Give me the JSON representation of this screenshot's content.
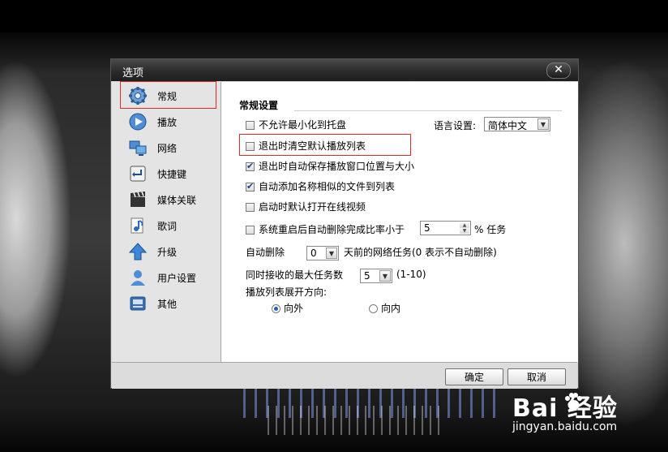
{
  "dialog": {
    "title": "选项",
    "close_glyph": "✕"
  },
  "sidebar": {
    "items": [
      {
        "label": "常规",
        "icon": "gear-icon",
        "active": true
      },
      {
        "label": "播放",
        "icon": "play-icon",
        "active": false
      },
      {
        "label": "网络",
        "icon": "network-icon",
        "active": false
      },
      {
        "label": "快捷键",
        "icon": "enter-key-icon",
        "active": false
      },
      {
        "label": "媒体关联",
        "icon": "film-clapper-icon",
        "active": false
      },
      {
        "label": "歌词",
        "icon": "lyrics-note-icon",
        "active": false
      },
      {
        "label": "升级",
        "icon": "upgrade-arrow-icon",
        "active": false
      },
      {
        "label": "用户设置",
        "icon": "user-icon",
        "active": false
      },
      {
        "label": "其他",
        "icon": "other-icon",
        "active": false
      }
    ]
  },
  "general": {
    "section_title": "常规设置",
    "opt_no_minimize_tray": {
      "label": "不允许最小化到托盘",
      "checked": false
    },
    "language_label": "语言设置:",
    "language_value": "简体中文",
    "opt_clear_playlist": {
      "label": "退出时清空默认播放列表",
      "checked": false
    },
    "opt_save_window_pos": {
      "label": "退出时自动保存播放窗口位置与大小",
      "checked": true
    },
    "opt_auto_add_similar": {
      "label": "自动添加名称相似的文件到列表",
      "checked": true
    },
    "opt_open_online_video": {
      "label": "启动时默认打开在线视频",
      "checked": false
    },
    "opt_auto_delete": {
      "label": "系统重启后自动删除完成比率小于",
      "checked": false
    },
    "auto_delete_value": "5",
    "auto_delete_suffix": "% 任务",
    "auto_delete_days_label": "自动删除",
    "auto_delete_days_value": "0",
    "auto_delete_days_suffix": "天前的网络任务(0 表示不自动删除)",
    "max_tasks_label": "同时接收的最大任务数",
    "max_tasks_value": "5",
    "max_tasks_range": "(1-10)",
    "playlist_expand_label": "播放列表展开方向:",
    "radio_out": {
      "label": "向外",
      "checked": true
    },
    "radio_in": {
      "label": "向内",
      "checked": false
    }
  },
  "footer": {
    "ok_label": "确定",
    "cancel_label": "取消"
  },
  "watermark": {
    "brand": "Bai  经验",
    "url": "jingyan.baidu.com"
  },
  "colors": {
    "highlight_red": "#e0282e",
    "accent_blue": "#1f5fbf"
  }
}
